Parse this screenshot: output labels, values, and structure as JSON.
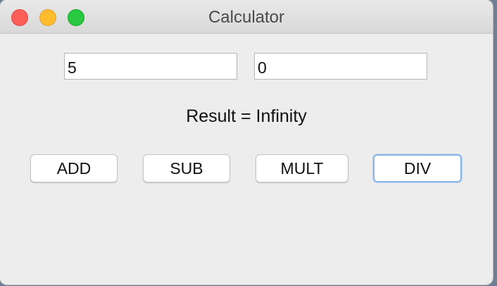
{
  "window": {
    "title": "Calculator"
  },
  "inputs": {
    "first_value": "5",
    "second_value": "0"
  },
  "result": {
    "text": "Result = Infinity"
  },
  "buttons": {
    "add": "ADD",
    "sub": "SUB",
    "mult": "MULT",
    "div": "DIV"
  },
  "colors": {
    "close": "#fc5f57",
    "minimize": "#fdbc2e",
    "zoom": "#28c840",
    "focus_ring": "#8ab4e6",
    "window_bg": "#ededed"
  }
}
